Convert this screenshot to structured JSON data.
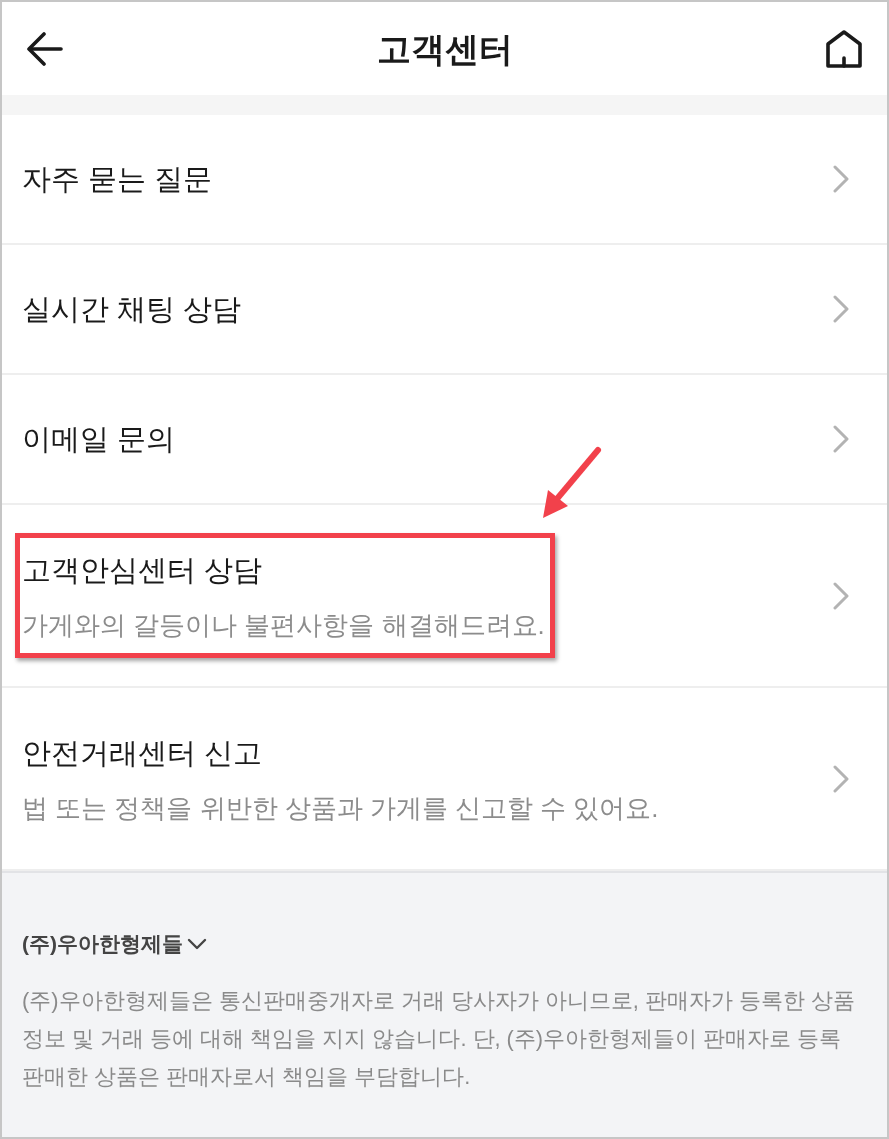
{
  "header": {
    "title": "고객센터"
  },
  "menu_items": [
    {
      "title": "자주 묻는 질문",
      "highlighted": false
    },
    {
      "title": "실시간 채팅 상담",
      "highlighted": false
    },
    {
      "title": "이메일 문의",
      "highlighted": false
    },
    {
      "title": "고객안심센터 상담",
      "description": "가게와의 갈등이나 불편사항을 해결해드려요.",
      "highlighted": true
    },
    {
      "title": "안전거래센터 신고",
      "description": "법 또는 정책을 위반한 상품과 가게를 신고할 수 있어요.",
      "highlighted": false
    }
  ],
  "footer": {
    "company": "(주)우아한형제들",
    "expanded": false,
    "notice": "(주)우아한형제들은 통신판매중개자로 거래 당사자가 아니므로, 판매자가 등록한 상품 정보 및 거래 등에 대해 책임을 지지 않습니다. 단, (주)우아한형제들이 판매자로 등록 판매한 상품은 판매자로서 책임을 부담합니다."
  }
}
